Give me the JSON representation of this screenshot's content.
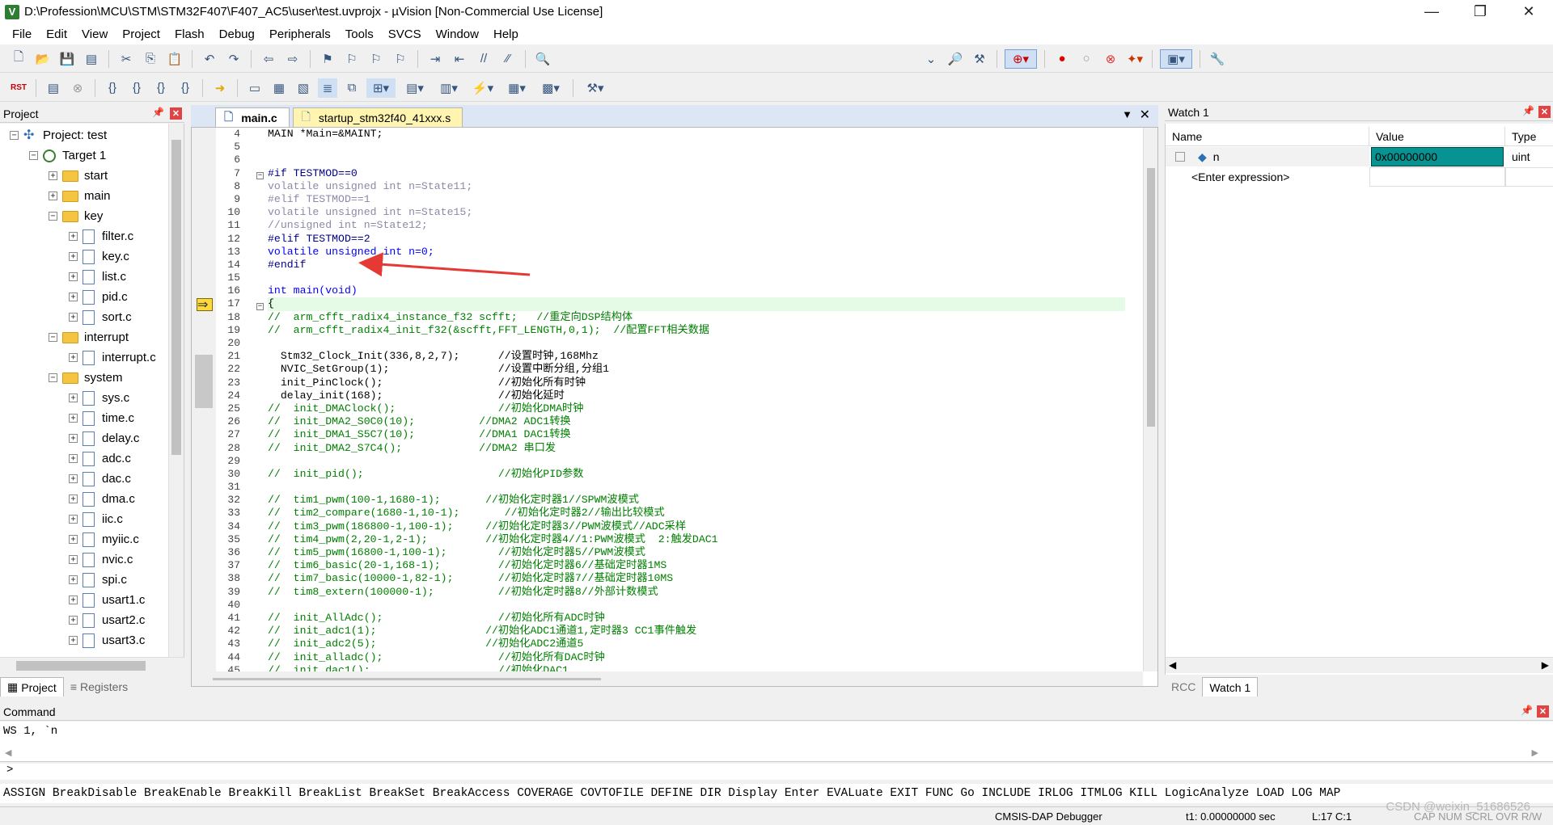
{
  "window": {
    "title": "D:\\Profession\\MCU\\STM\\STM32F407\\F407_AC5\\user\\test.uvprojx - µVision  [Non-Commercial Use License]",
    "app_icon": "V"
  },
  "menu": [
    "File",
    "Edit",
    "View",
    "Project",
    "Flash",
    "Debug",
    "Peripherals",
    "Tools",
    "SVCS",
    "Window",
    "Help"
  ],
  "project_panel": {
    "title": "Project",
    "root": "Project: test",
    "target": "Target 1",
    "tree": [
      {
        "label": "start",
        "kind": "folder",
        "indent": 2,
        "exp": "+"
      },
      {
        "label": "main",
        "kind": "folder",
        "indent": 2,
        "exp": "+"
      },
      {
        "label": "key",
        "kind": "folder",
        "indent": 2,
        "exp": "-"
      },
      {
        "label": "filter.c",
        "kind": "file",
        "indent": 3,
        "exp": "+"
      },
      {
        "label": "key.c",
        "kind": "file",
        "indent": 3,
        "exp": "+"
      },
      {
        "label": "list.c",
        "kind": "file",
        "indent": 3,
        "exp": "+"
      },
      {
        "label": "pid.c",
        "kind": "file",
        "indent": 3,
        "exp": "+"
      },
      {
        "label": "sort.c",
        "kind": "file",
        "indent": 3,
        "exp": "+"
      },
      {
        "label": "interrupt",
        "kind": "folder",
        "indent": 2,
        "exp": "-"
      },
      {
        "label": "interrupt.c",
        "kind": "file",
        "indent": 3,
        "exp": "+"
      },
      {
        "label": "system",
        "kind": "folder",
        "indent": 2,
        "exp": "-"
      },
      {
        "label": "sys.c",
        "kind": "file",
        "indent": 3,
        "exp": "+"
      },
      {
        "label": "time.c",
        "kind": "file",
        "indent": 3,
        "exp": "+"
      },
      {
        "label": "delay.c",
        "kind": "file",
        "indent": 3,
        "exp": "+"
      },
      {
        "label": "adc.c",
        "kind": "file",
        "indent": 3,
        "exp": "+"
      },
      {
        "label": "dac.c",
        "kind": "file",
        "indent": 3,
        "exp": "+"
      },
      {
        "label": "dma.c",
        "kind": "file",
        "indent": 3,
        "exp": "+"
      },
      {
        "label": "iic.c",
        "kind": "file",
        "indent": 3,
        "exp": "+"
      },
      {
        "label": "myiic.c",
        "kind": "file",
        "indent": 3,
        "exp": "+"
      },
      {
        "label": "nvic.c",
        "kind": "file",
        "indent": 3,
        "exp": "+"
      },
      {
        "label": "spi.c",
        "kind": "file",
        "indent": 3,
        "exp": "+"
      },
      {
        "label": "usart1.c",
        "kind": "file",
        "indent": 3,
        "exp": "+"
      },
      {
        "label": "usart2.c",
        "kind": "file",
        "indent": 3,
        "exp": "+"
      },
      {
        "label": "usart3.c",
        "kind": "file",
        "indent": 3,
        "exp": "+"
      }
    ],
    "tabs": [
      "Project",
      "Registers"
    ]
  },
  "editor": {
    "tabs": [
      "main.c",
      "startup_stm32f40_41xxx.s"
    ],
    "lines": [
      {
        "n": "4",
        "t": "MAIN *Main=&MAINT;",
        "c": "normal"
      },
      {
        "n": "5",
        "t": "",
        "c": "normal"
      },
      {
        "n": "6",
        "t": "",
        "c": "normal"
      },
      {
        "n": "7",
        "t": "#if TESTMOD==0",
        "c": "pre"
      },
      {
        "n": "8",
        "t": "volatile unsigned int n=State11;",
        "c": "grey"
      },
      {
        "n": "9",
        "t": "#elif TESTMOD==1",
        "c": "grey"
      },
      {
        "n": "10",
        "t": "volatile unsigned int n=State15;",
        "c": "grey"
      },
      {
        "n": "11",
        "t": "//unsigned int n=State12;",
        "c": "grey"
      },
      {
        "n": "12",
        "t": "#elif TESTMOD==2",
        "c": "pre"
      },
      {
        "n": "13",
        "t": "volatile unsigned int n=0;",
        "c": "kw"
      },
      {
        "n": "14",
        "t": "#endif",
        "c": "pre"
      },
      {
        "n": "15",
        "t": "",
        "c": "normal"
      },
      {
        "n": "16",
        "t": "int main(void)",
        "c": "kw"
      },
      {
        "n": "17",
        "t": "{",
        "c": "cur"
      },
      {
        "n": "18",
        "t": "//  arm_cfft_radix4_instance_f32 scfft;   //重定向DSP结构体",
        "c": "cm"
      },
      {
        "n": "19",
        "t": "//  arm_cfft_radix4_init_f32(&scfft,FFT_LENGTH,0,1);  //配置FFT相关数据",
        "c": "cm"
      },
      {
        "n": "20",
        "t": "",
        "c": "normal"
      },
      {
        "n": "21",
        "t": "  Stm32_Clock_Init(336,8,2,7);      //设置时钟,168Mhz",
        "c": "normal"
      },
      {
        "n": "22",
        "t": "  NVIC_SetGroup(1);                 //设置中断分组,分组1",
        "c": "normal"
      },
      {
        "n": "23",
        "t": "  init_PinClock();                  //初始化所有时钟",
        "c": "normal"
      },
      {
        "n": "24",
        "t": "  delay_init(168);                  //初始化延时",
        "c": "normal"
      },
      {
        "n": "25",
        "t": "//  init_DMAClock();                //初始化DMA时钟",
        "c": "cm"
      },
      {
        "n": "26",
        "t": "//  init_DMA2_S0C0(10);          //DMA2 ADC1转换",
        "c": "cm"
      },
      {
        "n": "27",
        "t": "//  init_DMA1_S5C7(10);          //DMA1 DAC1转换",
        "c": "cm"
      },
      {
        "n": "28",
        "t": "//  init_DMA2_S7C4();            //DMA2 串口发",
        "c": "cm"
      },
      {
        "n": "29",
        "t": "",
        "c": "normal"
      },
      {
        "n": "30",
        "t": "//  init_pid();                     //初始化PID参数",
        "c": "cm"
      },
      {
        "n": "31",
        "t": "",
        "c": "normal"
      },
      {
        "n": "32",
        "t": "//  tim1_pwm(100-1,1680-1);       //初始化定时器1//SPWM波模式",
        "c": "cm"
      },
      {
        "n": "33",
        "t": "//  tim2_compare(1680-1,10-1);       //初始化定时器2//输出比较模式",
        "c": "cm"
      },
      {
        "n": "34",
        "t": "//  tim3_pwm(186800-1,100-1);     //初始化定时器3//PWM波模式//ADC采样",
        "c": "cm"
      },
      {
        "n": "35",
        "t": "//  tim4_pwm(2,20-1,2-1);         //初始化定时器4//1:PWM波模式  2:触发DAC1",
        "c": "cm"
      },
      {
        "n": "36",
        "t": "//  tim5_pwm(16800-1,100-1);        //初始化定时器5//PWM波模式",
        "c": "cm"
      },
      {
        "n": "37",
        "t": "//  tim6_basic(20-1,168-1);         //初始化定时器6//基础定时器1MS",
        "c": "cm"
      },
      {
        "n": "38",
        "t": "//  tim7_basic(10000-1,82-1);       //初始化定时器7//基础定时器10MS",
        "c": "cm"
      },
      {
        "n": "39",
        "t": "//  tim8_extern(100000-1);          //初始化定时器8//外部计数模式",
        "c": "cm"
      },
      {
        "n": "40",
        "t": "",
        "c": "normal"
      },
      {
        "n": "41",
        "t": "//  init_AllAdc();                  //初始化所有ADC时钟",
        "c": "cm"
      },
      {
        "n": "42",
        "t": "//  init_adc1(1);                 //初始化ADC1通道1,定时器3 CC1事件触发",
        "c": "cm"
      },
      {
        "n": "43",
        "t": "//  init_adc2(5);                 //初始化ADC2通道5",
        "c": "cm"
      },
      {
        "n": "44",
        "t": "//  init_alladc();                  //初始化所有DAC时钟",
        "c": "cm"
      },
      {
        "n": "45",
        "t": "//  init_dac1();                    //初始化DAC1",
        "c": "cm"
      }
    ]
  },
  "watch": {
    "title": "Watch 1",
    "headers": [
      "Name",
      "Value",
      "Type"
    ],
    "rows": [
      {
        "name": "n",
        "value": "0x00000000",
        "type": "uint"
      },
      {
        "name": "<Enter expression>",
        "value": "",
        "type": ""
      }
    ],
    "tabs": [
      "RCC",
      "Watch 1"
    ]
  },
  "command": {
    "title": "Command",
    "output": "WS 1, `n",
    "prompt": ">",
    "keywords": "ASSIGN BreakDisable BreakEnable BreakKill BreakList BreakSet BreakAccess COVERAGE COVTOFILE DEFINE DIR Display Enter EVALuate EXIT FUNC Go INCLUDE IRLOG ITMLOG KILL LogicAnalyze LOAD LOG MAP"
  },
  "status": {
    "debugger": "CMSIS-DAP Debugger",
    "time": "t1: 0.00000000 sec",
    "position": "L:17 C:1",
    "indicators": "CAP  NUM  SCRL  OVR  R/W"
  },
  "watermark": "CSDN @weixin_51686526"
}
